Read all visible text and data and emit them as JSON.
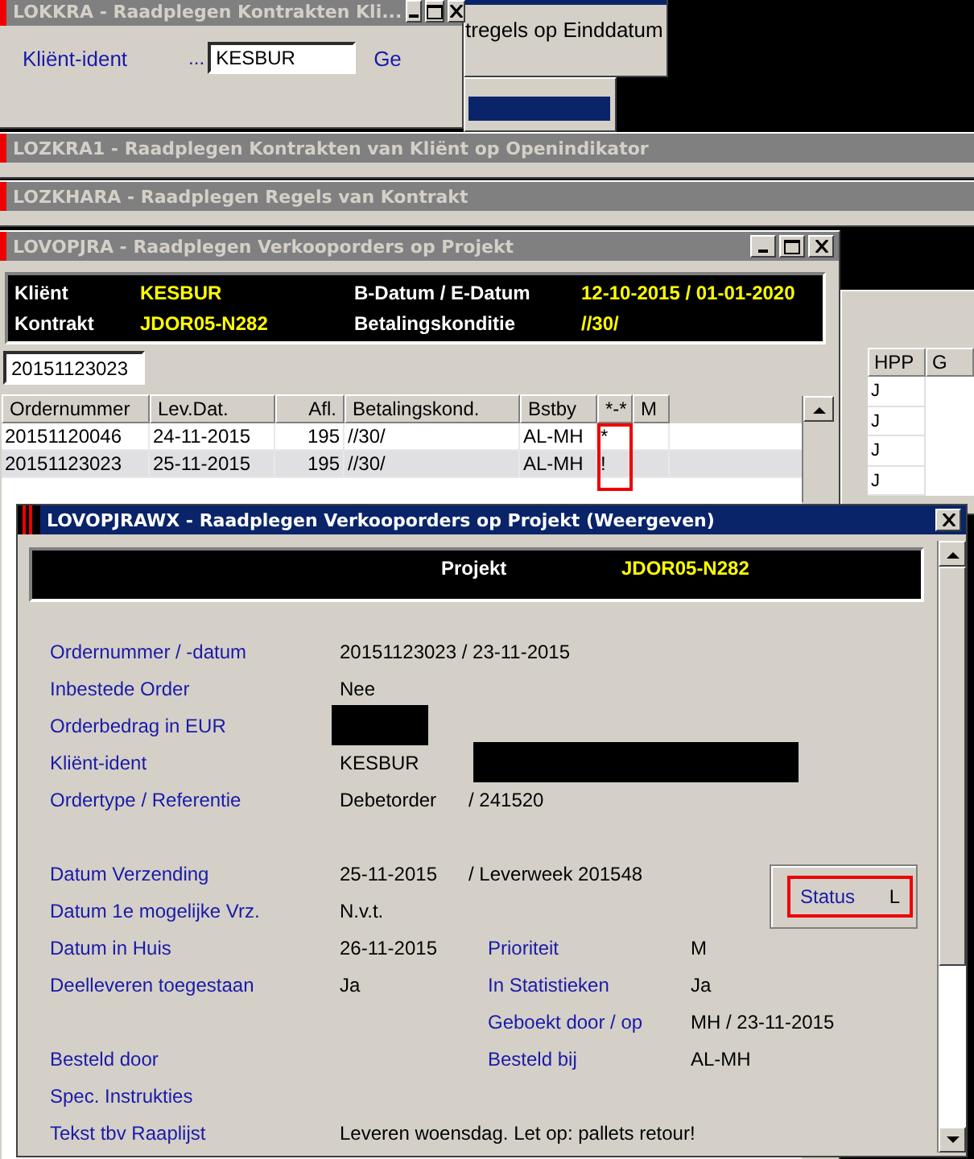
{
  "client_window": {
    "title": "LOKKRA - Raadplegen Kontrakten Kli...",
    "field_label": "Kliënt-ident",
    "lookup": "...",
    "field_value": "KESBUR",
    "cut_label": "Ge"
  },
  "menu_window": {
    "item": "tregels op Einddatum"
  },
  "collapsed_windows": [
    {
      "title": "LOZKRA1 - Raadplegen Kontrakten van Kliënt op Openindikator"
    },
    {
      "title": "LOZKHARA - Raadplegen Regels van Kontrakt"
    }
  ],
  "order_window": {
    "title": "LOVOPJRA - Raadplegen Verkooporders op Projekt",
    "header": [
      {
        "label": "Kliënt",
        "value": "KESBUR"
      },
      {
        "label": "B-Datum / E-Datum",
        "value": "12-10-2015 / 01-01-2020"
      },
      {
        "label": "Kontrakt",
        "value": "JDOR05-N282"
      },
      {
        "label": "Betalingskonditie",
        "value": "//30/"
      }
    ],
    "search_value": "20151123023",
    "columns": [
      {
        "label": "Ordernummer",
        "marked": false
      },
      {
        "label": "Lev.Dat.",
        "marked": false
      },
      {
        "label": "Afl.",
        "marked": false
      },
      {
        "label": "Betalingskond.",
        "marked": false
      },
      {
        "label": "Bstby",
        "marked": false
      },
      {
        "label": "*-*",
        "marked": true
      },
      {
        "label": "M",
        "marked": false
      }
    ],
    "rows": [
      {
        "cells": [
          "20151120046",
          "24-11-2015",
          "195",
          "//30/",
          "AL-MH",
          "*",
          ""
        ],
        "selected": false
      },
      {
        "cells": [
          "20151123023",
          "25-11-2015",
          "195",
          "//30/",
          "AL-MH",
          "!",
          ""
        ],
        "selected": true
      }
    ]
  },
  "side_grid": {
    "columns": [
      "HPP",
      "G"
    ],
    "rows": [
      "J",
      "J",
      "J",
      "J"
    ]
  },
  "detail_window": {
    "title": "LOVOPJRAWX - Raadplegen Verkooporders op Projekt (Weergeven)",
    "header": {
      "label": "Projekt",
      "value": "JDOR05-N282"
    },
    "field_groups": [
      [
        {
          "label": "Ordernummer / -datum",
          "value": "20151123023 / 23-11-2015"
        },
        {
          "label": "Inbestede Order",
          "value": "Nee"
        },
        {
          "label": "Orderbedrag in EUR",
          "value_redacted": true
        },
        {
          "label": "Kliënt-ident",
          "value": "KESBUR",
          "extra_redacted": true
        },
        {
          "label": "Ordertype / Referentie",
          "value": "Debetorder",
          "extra": "/ 241520"
        }
      ],
      [
        {
          "label": "Datum Verzending",
          "value": "25-11-2015",
          "extra": "/ Leverweek 201548"
        },
        {
          "label": "Datum 1e mogelijke Vrz.",
          "value": "N.v.t."
        },
        {
          "label": "Datum in Huis",
          "value": "26-11-2015",
          "side_label": "Prioriteit",
          "side_value": "M"
        },
        {
          "label": "Deelleveren toegestaan",
          "value": "Ja",
          "side_label": "In Statistieken",
          "side_value": "Ja"
        },
        {
          "side_label": "Geboekt door / op",
          "side_value": "MH / 23-11-2015"
        },
        {
          "label": "Besteld door",
          "side_label": "Besteld bij",
          "side_value": "AL-MH"
        },
        {
          "label": "Spec. Instrukties"
        },
        {
          "label": "Tekst tbv Raaplijst",
          "value": "Leveren woensdag. Let op: pallets retour!"
        }
      ]
    ],
    "status": {
      "label": "Status",
      "value": "L",
      "marked": true
    }
  }
}
